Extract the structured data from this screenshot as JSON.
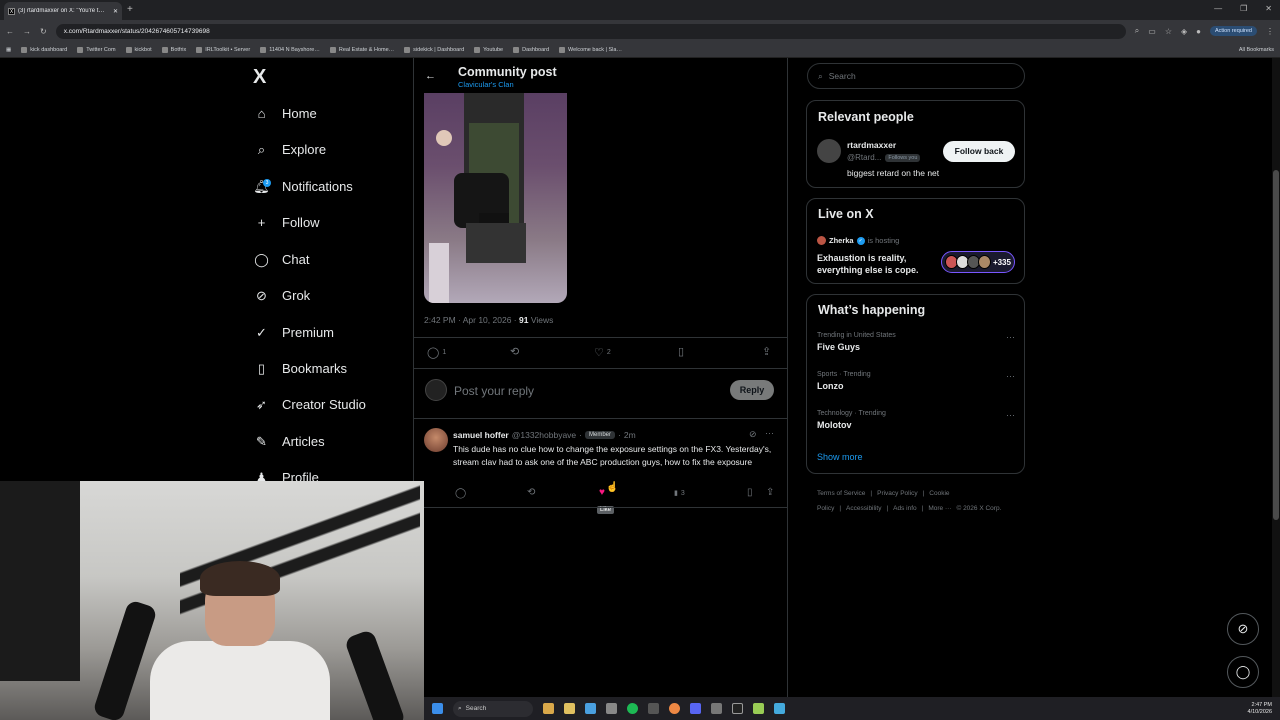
{
  "browser": {
    "tab_title": "(3) rtardmaxxer on X: \"You're t…",
    "tab_favicon": "X",
    "url": "x.com/Rtardmaxxer/status/2042674605714739698",
    "action_required": "Action required",
    "bookmarks": [
      "kick dashboard",
      "Twitter Com",
      "kickbot",
      "Botfrix",
      "IRLToolkit • Server",
      "11404 N Bayshore…",
      "Real Estate & Home…",
      "sidekick | Dashboard",
      "Youtube",
      "Dashboard",
      "Welcome back | Sla…"
    ],
    "all_bookmarks": "All Bookmarks"
  },
  "nav": {
    "logo": "X",
    "items": [
      {
        "label": "Home",
        "icon": "home-icon"
      },
      {
        "label": "Explore",
        "icon": "search-icon"
      },
      {
        "label": "Notifications",
        "icon": "bell-icon"
      },
      {
        "label": "Follow",
        "icon": "add-user-icon"
      },
      {
        "label": "Chat",
        "icon": "chat-icon"
      },
      {
        "label": "Grok",
        "icon": "grok-icon"
      },
      {
        "label": "Premium",
        "icon": "premium-icon"
      },
      {
        "label": "Bookmarks",
        "icon": "bookmark-icon"
      },
      {
        "label": "Creator Studio",
        "icon": "rocket-icon"
      },
      {
        "label": "Articles",
        "icon": "article-icon"
      },
      {
        "label": "Profile",
        "icon": "user-icon"
      }
    ],
    "notif_badge": "3"
  },
  "post": {
    "header_title": "Community post",
    "header_sub": "Clavicular's Clan",
    "time": "2:42 PM · Apr 10, 2026 · ",
    "views_count": "91",
    "views_label": " Views",
    "replies": "1",
    "likes": "2",
    "reply_placeholder": "Post your reply",
    "reply_button": "Reply"
  },
  "comment": {
    "name": "samuel hoffer",
    "handle": "@1332hobbyave",
    "dot": "·",
    "badge": "Member",
    "time": "2m",
    "text": "This dude has no clue how to change the exposure settings on the FX3. Yesterday's, stream clav had to ask one of the ABC production guys, how to fix the exposure",
    "views": "3",
    "tooltip": "Like"
  },
  "right": {
    "search_placeholder": "Search",
    "relevant_title": "Relevant people",
    "rp_name": "rtardmaxxer",
    "rp_handle": "@Rtard...",
    "rp_follows": "Follows you",
    "rp_bio": "biggest retard on the net",
    "follow_back": "Follow back",
    "live_title": "Live on X",
    "live_host": "Zherka",
    "live_hosting": "is hosting",
    "live_space": "Exhaustion is reality, everything else is cope.",
    "live_count": "+335",
    "happening_title": "What’s happening",
    "trends": [
      {
        "context": "Trending in United States",
        "name": "Five Guys"
      },
      {
        "context": "Sports · Trending",
        "name": "Lonzo"
      },
      {
        "context": "Technology · Trending",
        "name": "Molotov"
      }
    ],
    "show_more": "Show more",
    "footer": [
      "Terms of Service",
      "|",
      "Privacy Policy",
      "|",
      "Cookie Policy",
      "|",
      "Accessibility",
      "|",
      "Ads info",
      "|",
      "More ···",
      "© 2026 X Corp."
    ]
  },
  "taskbar": {
    "search": "Search",
    "time": "2:47 PM",
    "date": "4/10/2026"
  },
  "colors": {
    "accent": "#1d9bf0",
    "background": "#000000",
    "border": "#2f3336",
    "muted": "#71767b"
  }
}
